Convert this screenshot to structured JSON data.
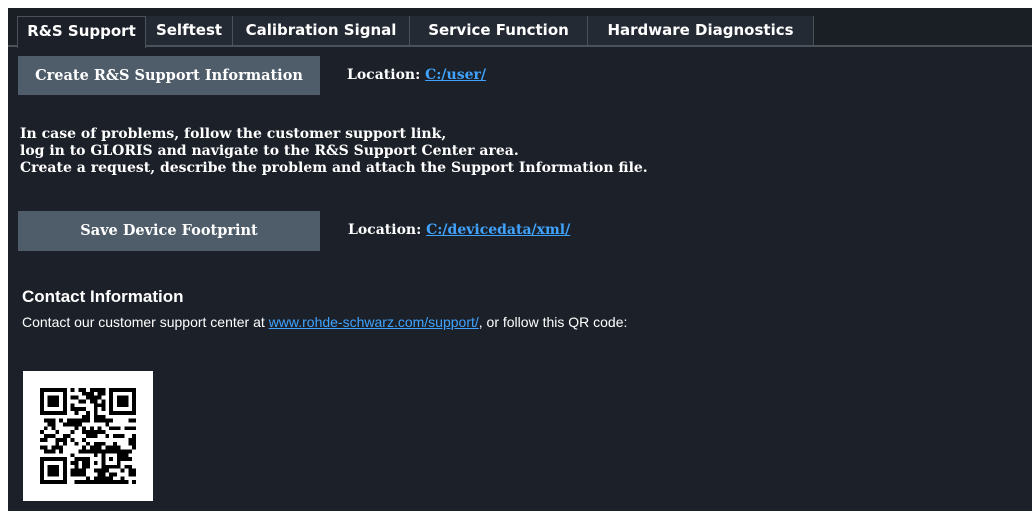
{
  "tabs": [
    {
      "label": "R&S Support",
      "active": true
    },
    {
      "label": "Selftest",
      "active": false
    },
    {
      "label": "Calibration Signal",
      "active": false
    },
    {
      "label": "Service Function",
      "active": false
    },
    {
      "label": "Hardware Diagnostics",
      "active": false
    }
  ],
  "support_info": {
    "button_label": "Create R&S Support Information",
    "location_label": "Location:",
    "location_link": "C:/user/"
  },
  "help_text": [
    "In case of problems, follow the customer support link,",
    "log in to GLORIS and navigate to the R&S Support Center area.",
    "Create a request, describe the problem and attach the Support Information file."
  ],
  "footprint": {
    "button_label": "Save Device Footprint",
    "location_label": "Location:",
    "location_link": "C:/devicedata/xml/"
  },
  "contact": {
    "title": "Contact Information",
    "text_before": "Contact our customer support center at ",
    "link": "www.rohde-schwarz.com/support/",
    "text_after": ", or follow this QR code:"
  },
  "colors": {
    "background": "#1c2129",
    "button": "#4f5c6a",
    "link": "#3fa3ff"
  },
  "icons": {
    "qr": "qr-code-icon"
  }
}
